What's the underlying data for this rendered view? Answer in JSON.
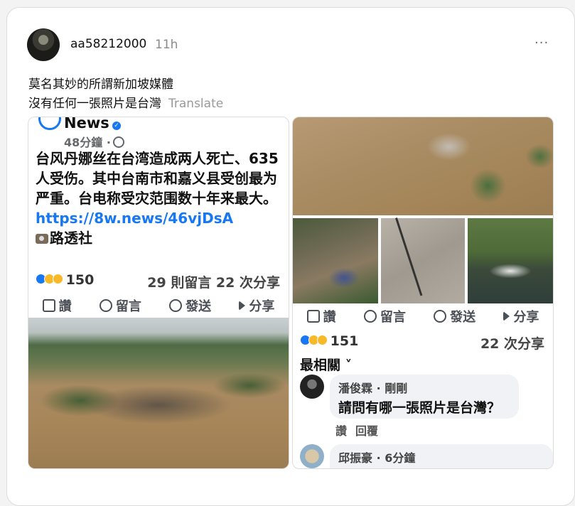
{
  "post": {
    "username": "aa58212000",
    "time": "11h",
    "more": "···",
    "caption_line1": "莫名其妙的所謂新加坡媒體",
    "caption_line2": "沒有任何一張照片是台灣",
    "translate": "Translate"
  },
  "left_panel": {
    "page_name": "News",
    "meta": "48分鐘 ·",
    "body_text": "台风丹娜丝在台湾造成两人死亡、635人受伤。其中台南市和嘉义县受创最为严重。台电称受灾范围数十年来最大。",
    "link": "https://8w.news/46vjDsA",
    "credit": "路透社",
    "reaction_count": "150",
    "counts": "29 則留言  22 次分享",
    "actions": {
      "like": "讚",
      "comment": "留言",
      "send": "發送",
      "share": "分享"
    }
  },
  "right_panel": {
    "actions": {
      "like": "讚",
      "comment": "留言",
      "send": "發送",
      "share": "分享"
    },
    "reaction_count": "151",
    "counts": "22 次分享",
    "most_relevant": "最相關 ˅",
    "comments": [
      {
        "name": "潘俊霖 · 剛剛",
        "text": "請問有哪一張照片是台灣？"
      },
      {
        "name": "邱振豪 · 6分鐘",
        "text": ""
      }
    ],
    "comment_actions": {
      "like": "讚",
      "reply": "回覆"
    }
  }
}
